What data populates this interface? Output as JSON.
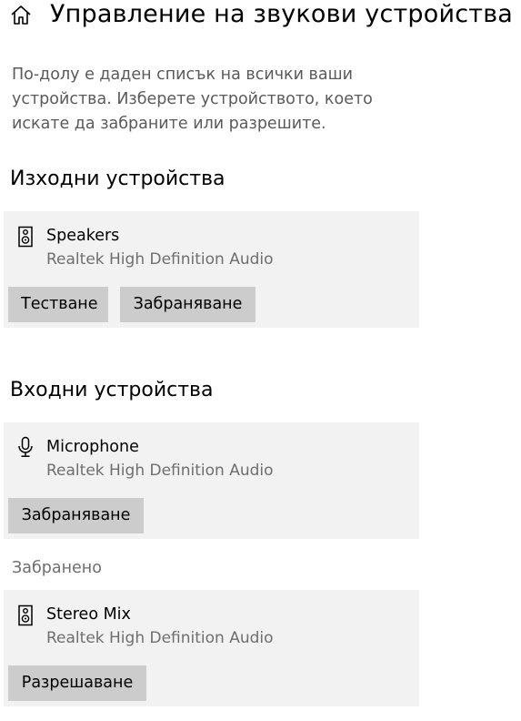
{
  "header": {
    "title": "Управление на звукови устройства",
    "home_icon": "home-icon"
  },
  "description": "По-долу е даден списък на всички ваши устройства. Изберете устройството, което искате да забраните или разрешите.",
  "output_section": {
    "heading": "Изходни устройства",
    "devices": [
      {
        "icon": "speaker-icon",
        "name": "Speakers",
        "driver": "Realtek High Definition Audio",
        "buttons": [
          "Тестване",
          "Забраняване"
        ]
      }
    ]
  },
  "input_section": {
    "heading": "Входни устройства",
    "devices": [
      {
        "icon": "microphone-icon",
        "name": "Microphone",
        "driver": "Realtek High Definition Audio",
        "buttons": [
          "Забраняване"
        ]
      }
    ],
    "disabled_label": "Забранено",
    "disabled_devices": [
      {
        "icon": "speaker-icon",
        "name": "Stereo Mix",
        "driver": "Realtek High Definition Audio",
        "buttons": [
          "Разрешаване"
        ]
      }
    ]
  },
  "colors": {
    "card_background": "#f2f2f2",
    "button_background": "#cccccc",
    "secondary_text": "#6e6e6e"
  }
}
